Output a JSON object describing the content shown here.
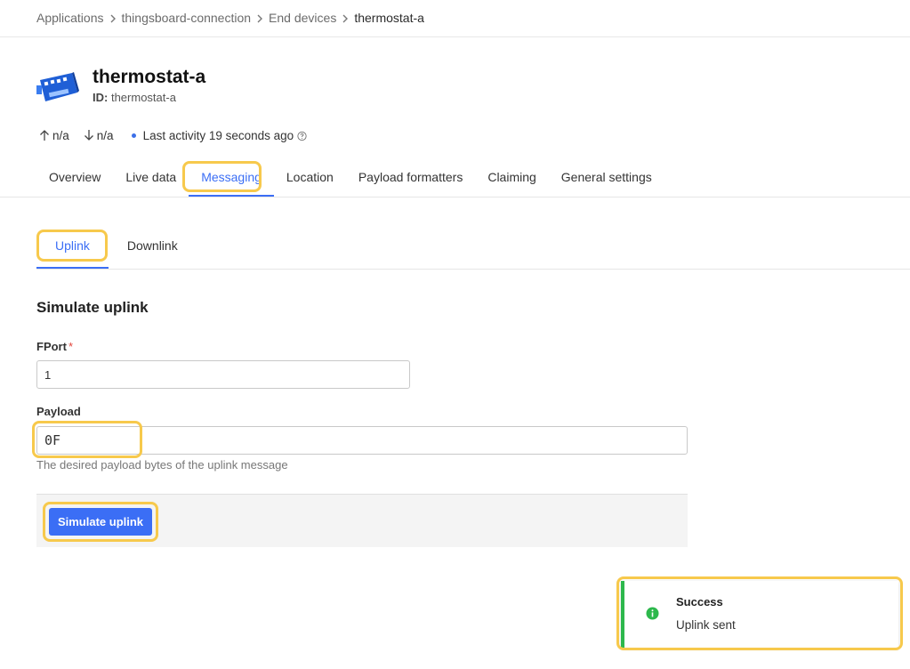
{
  "breadcrumb": {
    "items": [
      "Applications",
      "thingsboard-connection",
      "End devices",
      "thermostat-a"
    ]
  },
  "device": {
    "title": "thermostat-a",
    "id_label": "ID:",
    "id_value": "thermostat-a",
    "uplink_count": "n/a",
    "downlink_count": "n/a",
    "last_activity": "Last activity 19 seconds ago"
  },
  "tabs": [
    {
      "label": "Overview"
    },
    {
      "label": "Live data"
    },
    {
      "label": "Messaging",
      "active": true
    },
    {
      "label": "Location"
    },
    {
      "label": "Payload formatters"
    },
    {
      "label": "Claiming"
    },
    {
      "label": "General settings"
    }
  ],
  "subtabs": [
    {
      "label": "Uplink",
      "active": true
    },
    {
      "label": "Downlink"
    }
  ],
  "form": {
    "title": "Simulate uplink",
    "fport_label": "FPort",
    "fport_required": "*",
    "fport_value": "1",
    "payload_label": "Payload",
    "payload_value": "0F",
    "payload_hint": "The desired payload bytes of the uplink message",
    "submit_label": "Simulate uplink"
  },
  "toast": {
    "title": "Success",
    "message": "Uplink sent",
    "accent_color": "#2db84c"
  },
  "colors": {
    "accent": "#3b6ef5",
    "highlight": "#f7c94c"
  },
  "icons": [
    "chevron-right-icon",
    "device-icon",
    "arrow-up-icon",
    "arrow-down-icon",
    "help-circle-icon",
    "info-circle-icon"
  ]
}
